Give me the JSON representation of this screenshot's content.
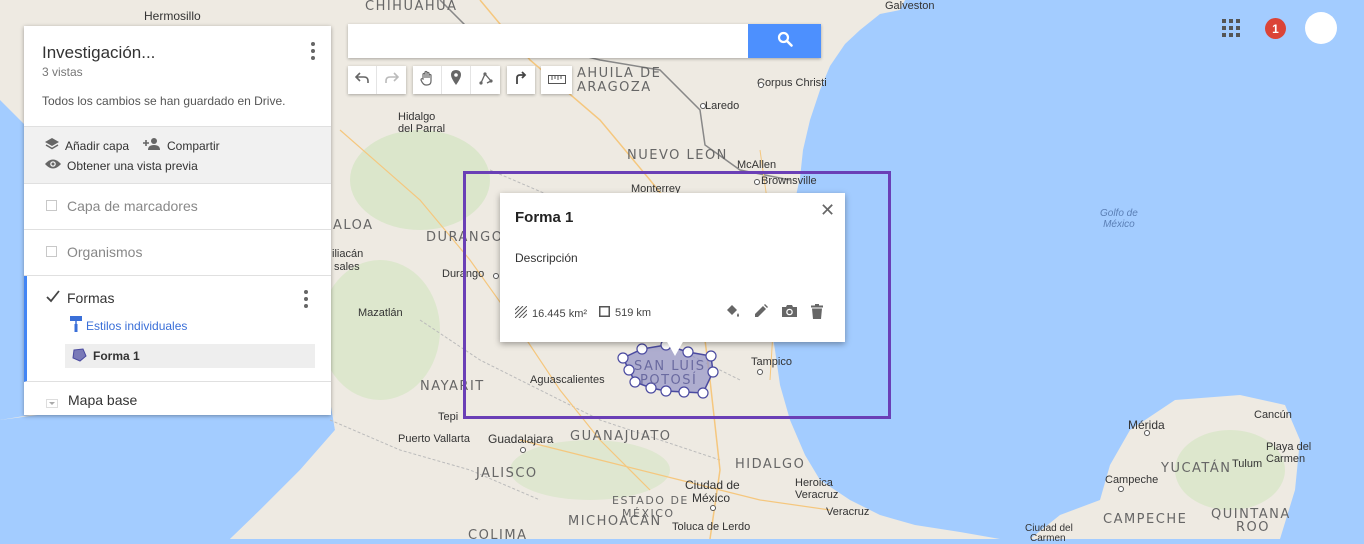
{
  "map_labels": {
    "hermosillo": "Hermosillo",
    "chihuahua": "CHIHUAHUA",
    "galveston": "Galveston",
    "coahuila_1": "AHUILA DE",
    "coahuila_2": "ARAGOZA",
    "corpus_christi": "Corpus Christi",
    "laredo": "Laredo",
    "hidalgo_parral_1": "Hidalgo",
    "hidalgo_parral_2": "del Parral",
    "nuevo_leon": "NUEVO LEON",
    "mcallen": "McAllen",
    "brownsville": "Brownsville",
    "monterrey": "Monterrey",
    "golfo_mexico": "Golfo de\nMéxico",
    "durango_state": "DURANGO",
    "sinaloa_fragment": "ALOA",
    "culiacan_fragment": "iliacán",
    "rosales_fragment": "sales",
    "durango_city": "Durango",
    "mazatlan": "Mazatlán",
    "tampico": "Tampico",
    "aguascalientes": "Aguascalientes",
    "san_luis_1": "SAN LUIS",
    "san_luis_2": "POTOSÍ",
    "nayarit": "NAYARIT",
    "tepic_fragment": "Tepi",
    "puerto_vallarta": "Puerto Vallarta",
    "guadalajara": "Guadalajara",
    "guanajuato": "GUANAJUATO",
    "jalisco": "JALISCO",
    "ciudad_mexico_1": "Ciudad de",
    "ciudad_mexico_2": "México",
    "hidalgo_state": "HIDALGO",
    "estado_mexico_1": "ESTADO DE",
    "estado_mexico_2": "MÉXICO",
    "michoacan": "MICHOACÁN",
    "heroica_1": "Heroica",
    "heroica_2": "Veracruz",
    "veracruz": "Veracruz",
    "toluca_fragment": "Toluca de Lerdo",
    "colima_fragment": "COLIMA",
    "merida": "Mérida",
    "cancun": "Cancún",
    "playa_1": "Playa del",
    "playa_2": "Carmen",
    "tulum": "Tulum",
    "yucatan": "YUCATÁN",
    "campeche_city": "Campeche",
    "campeche_state": "CAMPECHE",
    "quintana_1": "QUINTANA",
    "quintana_2": "ROO",
    "ciudad_carmen_1": "Ciudad del",
    "ciudad_carmen_2": "Carmen"
  },
  "panel": {
    "title": "Investigación...",
    "views": "3 vistas",
    "saved": "Todos los cambios se han guardado en Drive.",
    "add_layer": "Añadir capa",
    "share": "Compartir",
    "preview": "Obtener una vista previa",
    "layers": [
      {
        "label": "Capa de marcadores"
      },
      {
        "label": "Organismos"
      }
    ],
    "active_layer": {
      "label": "Formas",
      "style": "Estilos individuales",
      "feature": "Forma 1"
    },
    "basemap": "Mapa base"
  },
  "search": {
    "value": "",
    "placeholder": ""
  },
  "toolbar_icons": [
    "undo-icon",
    "redo-icon",
    "hand-icon",
    "marker-icon",
    "draw-line-icon",
    "directions-icon",
    "ruler-icon"
  ],
  "header": {
    "notifications": "1"
  },
  "info_window": {
    "title": "Forma 1",
    "description": "Descripción",
    "area": "16.445 km²",
    "perimeter": "519 km"
  },
  "colors": {
    "accent": "#4285f4",
    "search_button": "#4d90fe",
    "highlight_box": "#6a3fb6",
    "notification": "#db4437",
    "water": "#a3ccff"
  }
}
